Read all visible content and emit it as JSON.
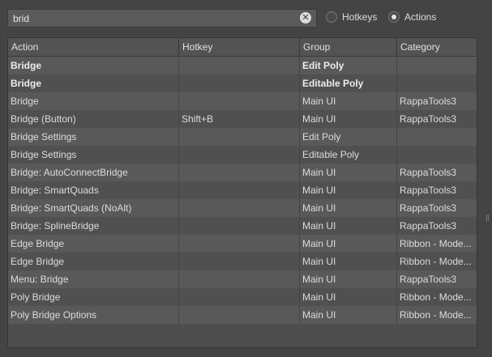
{
  "search": {
    "value": "brid",
    "clear_glyph": "✕"
  },
  "filter": {
    "hotkeys_label": "Hotkeys",
    "actions_label": "Actions",
    "selected": "Actions"
  },
  "table": {
    "columns": [
      "Action",
      "Hotkey",
      "Group",
      "Category"
    ],
    "rows": [
      {
        "action": "Bridge",
        "hotkey": "",
        "group": "Edit Poly",
        "category": "",
        "bold": true
      },
      {
        "action": "Bridge",
        "hotkey": "",
        "group": "Editable Poly",
        "category": "",
        "bold": true
      },
      {
        "action": "Bridge",
        "hotkey": "",
        "group": "Main UI",
        "category": "RappaTools3",
        "bold": false
      },
      {
        "action": "Bridge (Button)",
        "hotkey": "Shift+B",
        "group": "Main UI",
        "category": "RappaTools3",
        "bold": false
      },
      {
        "action": "Bridge Settings",
        "hotkey": "",
        "group": "Edit Poly",
        "category": "",
        "bold": false
      },
      {
        "action": "Bridge Settings",
        "hotkey": "",
        "group": "Editable Poly",
        "category": "",
        "bold": false
      },
      {
        "action": "Bridge: AutoConnectBridge",
        "hotkey": "",
        "group": "Main UI",
        "category": "RappaTools3",
        "bold": false
      },
      {
        "action": "Bridge: SmartQuads",
        "hotkey": "",
        "group": "Main UI",
        "category": "RappaTools3",
        "bold": false
      },
      {
        "action": "Bridge: SmartQuads (NoAlt)",
        "hotkey": "",
        "group": "Main UI",
        "category": "RappaTools3",
        "bold": false
      },
      {
        "action": "Bridge: SplineBridge",
        "hotkey": "",
        "group": "Main UI",
        "category": "RappaTools3",
        "bold": false
      },
      {
        "action": "Edge Bridge",
        "hotkey": "",
        "group": "Main UI",
        "category": "Ribbon - Mode...",
        "bold": false
      },
      {
        "action": "Edge Bridge",
        "hotkey": "",
        "group": "Main UI",
        "category": "Ribbon - Mode...",
        "bold": false
      },
      {
        "action": "Menu: Bridge",
        "hotkey": "",
        "group": "Main UI",
        "category": "RappaTools3",
        "bold": false
      },
      {
        "action": "Poly Bridge",
        "hotkey": "",
        "group": "Main UI",
        "category": "Ribbon - Mode...",
        "bold": false
      },
      {
        "action": "Poly Bridge Options",
        "hotkey": "",
        "group": "Main UI",
        "category": "Ribbon - Mode...",
        "bold": false
      }
    ]
  }
}
